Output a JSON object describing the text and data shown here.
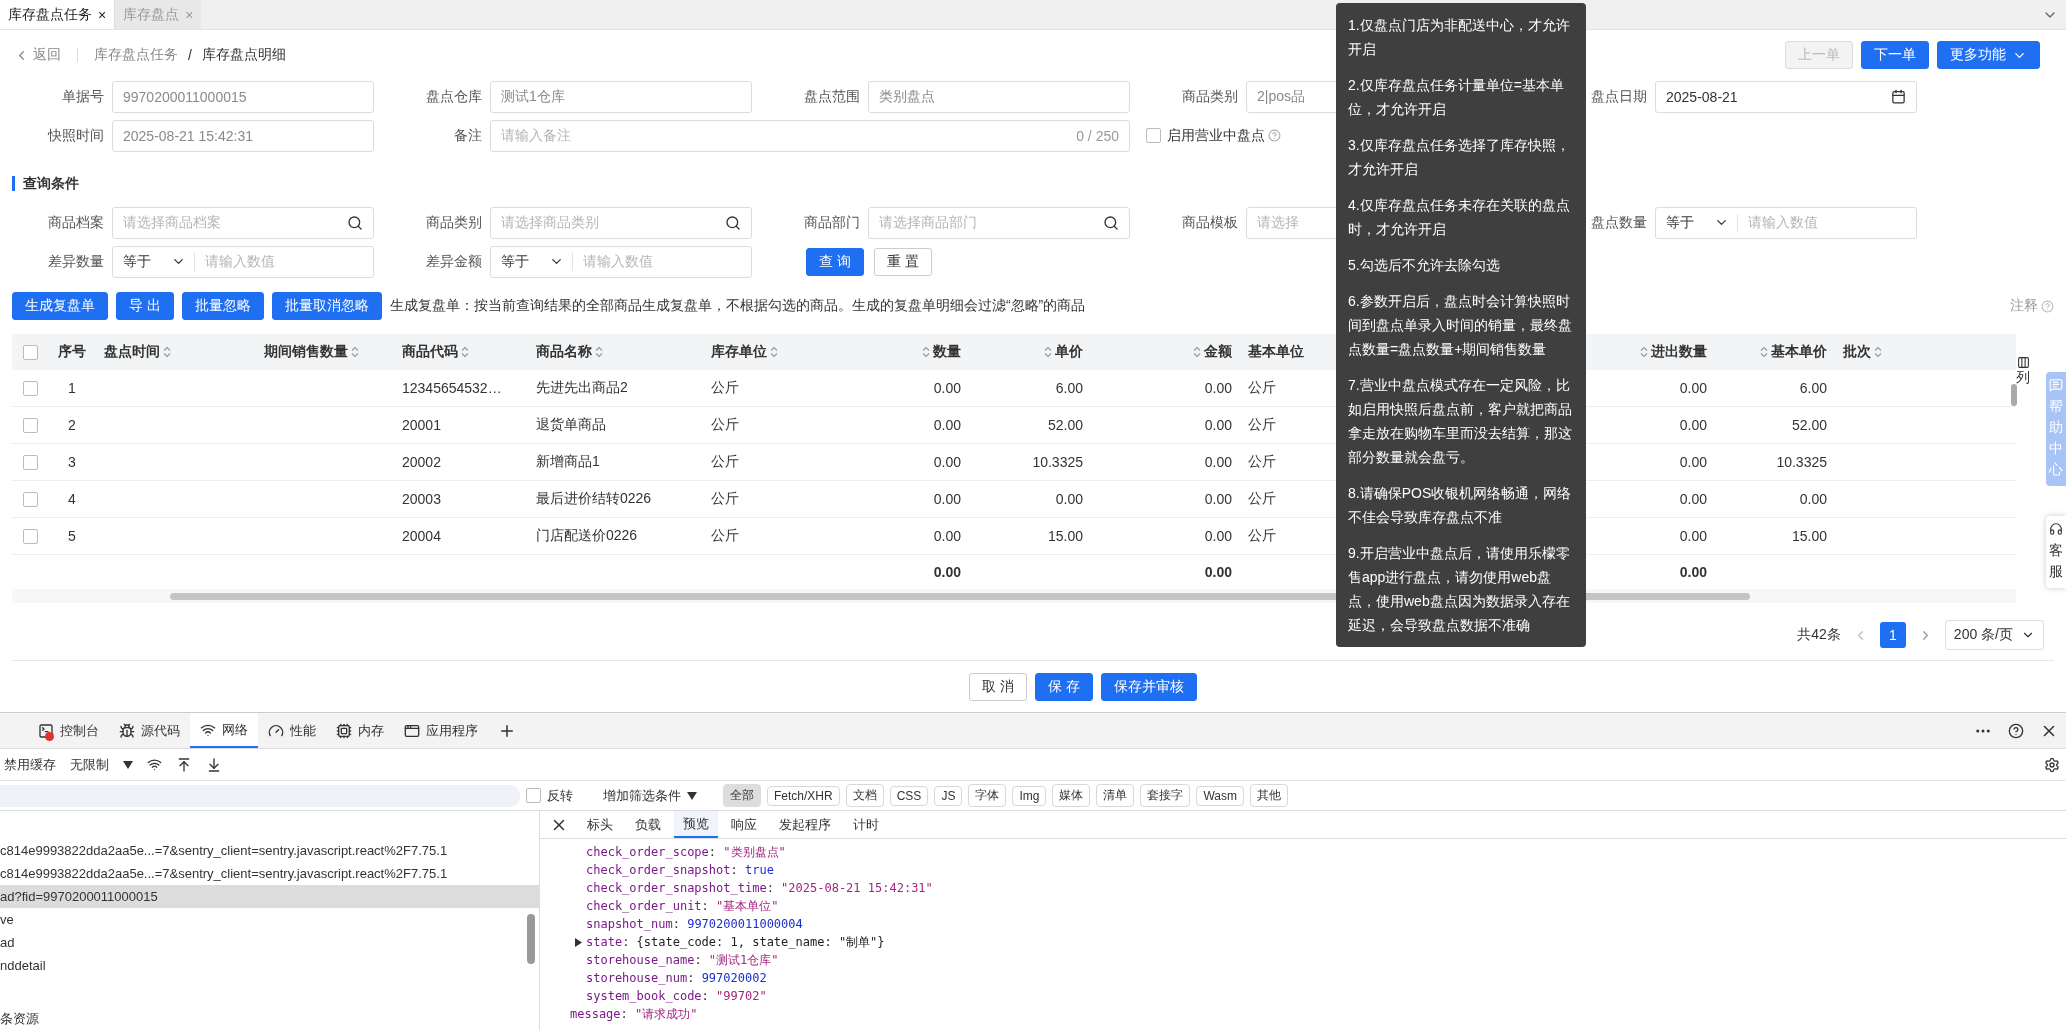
{
  "tabs": [
    {
      "label": "库存盘点任务",
      "close": "×",
      "selected": true
    },
    {
      "label": "库存盘点",
      "close": "×",
      "selected": false
    }
  ],
  "header": {
    "back": "返回",
    "breadcrumb": [
      "库存盘点任务",
      "库存盘点明细"
    ],
    "separator": "/",
    "buttons": [
      {
        "label": "上一单",
        "kind": "default",
        "disabled": true
      },
      {
        "label": "下一单",
        "kind": "primary",
        "disabled": false
      },
      {
        "label": "更多功能",
        "kind": "dropdown",
        "disabled": false
      }
    ]
  },
  "form": {
    "rows": [
      [
        {
          "label": "单据号",
          "kind": "text",
          "value": "9970200011000015",
          "disabled": true
        },
        {
          "label": "盘点仓库",
          "kind": "text",
          "value": "测试1仓库",
          "disabled": true
        },
        {
          "label": "盘点范围",
          "kind": "text",
          "value": "类别盘点",
          "disabled": true
        },
        {
          "label": "商品类别",
          "kind": "text",
          "value": "2|pos品",
          "disabled": true
        },
        {
          "label": "盘点日期",
          "kind": "date",
          "value": "2025-08-21"
        }
      ],
      [
        {
          "label": "快照时间",
          "kind": "text",
          "value": "2025-08-21 15:42:31",
          "disabled": true
        },
        {
          "label": "备注",
          "kind": "textarea",
          "placeholder": "请输入备注",
          "counter": "0 / 250"
        },
        "",
        {
          "kind": "checkbox",
          "text": "启用营业中盘点",
          "checked": false
        }
      ]
    ]
  },
  "query": {
    "title": "查询条件",
    "rows": [
      [
        {
          "label": "商品档案",
          "kind": "search",
          "placeholder": "请选择商品档案"
        },
        {
          "label": "商品类别",
          "kind": "search",
          "placeholder": "请选择商品类别"
        },
        {
          "label": "商品部门",
          "kind": "search",
          "placeholder": "请选择商品部门"
        },
        {
          "label": "商品模板",
          "kind": "partial",
          "placeholder": "请选择"
        },
        {
          "label": "盘点数量",
          "kind": "compare",
          "option": "等于",
          "placeholder": "请输入数值"
        }
      ],
      [
        {
          "label": "差异数量",
          "kind": "compare",
          "option": "等于",
          "placeholder": "请输入数值"
        },
        {
          "label": "差异金额",
          "kind": "compare",
          "option": "等于",
          "placeholder": "请输入数值"
        },
        {
          "kind": "buttons",
          "buttons": [
            {
              "label": "查 询",
              "kind": "primary"
            },
            {
              "label": "重 置",
              "kind": "default"
            }
          ]
        }
      ]
    ]
  },
  "actions": {
    "buttons": [
      "生成复盘单",
      "导 出",
      "批量忽略",
      "批量取消忽略"
    ],
    "note": "生成复盘单：按当前查询结果的全部商品生成复盘单，不根据勾选的商品。生成的复盘单明细会过滤“忽略”的商品",
    "annotation": "注释"
  },
  "table": {
    "all_selected": false,
    "column_settings": "列",
    "columns": [
      {
        "label": "序号",
        "kind": "index",
        "sortable": false
      },
      {
        "label": "盘点时间",
        "kind": "text",
        "sortable": true
      },
      {
        "label": "期间销售数量",
        "kind": "text",
        "sortable": true
      },
      {
        "label": "商品代码",
        "kind": "text",
        "sortable": true
      },
      {
        "label": "商品名称",
        "kind": "text",
        "sortable": true
      },
      {
        "label": "库存单位",
        "kind": "text",
        "sortable": true
      },
      {
        "label": "数量",
        "kind": "number",
        "sortable": true,
        "total": "0.00"
      },
      {
        "label": "单价",
        "kind": "number",
        "sortable": true
      },
      {
        "label": "金额",
        "kind": "number",
        "sortable": true,
        "total": "0.00"
      },
      {
        "label": "基本单位",
        "kind": "text",
        "sortable": false
      },
      {
        "label": "进出数量",
        "kind": "number",
        "sortable": true,
        "total": "0.00"
      },
      {
        "label": "基本单价",
        "kind": "number",
        "sortable": true
      },
      {
        "label": "批次",
        "kind": "text",
        "sortable": true
      }
    ],
    "rows": [
      {
        "selected": false,
        "cells": [
          "1",
          "",
          "",
          "12345654532…",
          "先进先出商品2",
          "公斤",
          "0.00",
          "6.00",
          "0.00",
          "公斤",
          "0.00",
          "6.00",
          ""
        ]
      },
      {
        "selected": false,
        "cells": [
          "2",
          "",
          "",
          "20001",
          "退货单商品",
          "公斤",
          "0.00",
          "52.00",
          "0.00",
          "公斤",
          "0.00",
          "52.00",
          ""
        ]
      },
      {
        "selected": false,
        "cells": [
          "3",
          "",
          "",
          "20002",
          "新增商品1",
          "公斤",
          "0.00",
          "10.3325",
          "0.00",
          "公斤",
          "0.00",
          "10.3325",
          ""
        ]
      },
      {
        "selected": false,
        "cells": [
          "4",
          "",
          "",
          "20003",
          "最后进价结转0226",
          "公斤",
          "0.00",
          "0.00",
          "0.00",
          "公斤",
          "0.00",
          "0.00",
          ""
        ]
      },
      {
        "selected": false,
        "cells": [
          "5",
          "",
          "",
          "20004",
          "门店配送价0226",
          "公斤",
          "0.00",
          "15.00",
          "0.00",
          "公斤",
          "0.00",
          "15.00",
          ""
        ]
      }
    ]
  },
  "pagination": {
    "total": "共42条",
    "pages": [
      {
        "label": "1",
        "selected": true
      }
    ],
    "page_size": "200 条/页"
  },
  "footer": {
    "buttons": [
      {
        "label": "取 消",
        "kind": "default"
      },
      {
        "label": "保 存",
        "kind": "primary"
      },
      {
        "label": "保存并审核",
        "kind": "primary"
      }
    ]
  },
  "tooltip": {
    "items": [
      "1.仅盘点门店为非配送中心，才允许开启",
      "2.仅库存盘点任务计量单位=基本单位，才允许开启",
      "3.仅库存盘点任务选择了库存快照，才允许开启",
      "4.仅库存盘点任务未存在关联的盘点时，才允许开启",
      "5.勾选后不允许去除勾选",
      "6.参数开启后，盘点时会计算快照时间到盘点单录入时间的销量，最终盘点数量=盘点数量+期间销售数量",
      "7.营业中盘点模式存在一定风险，比如启用快照后盘点前，客户就把商品拿走放在购物车里而没去结算，那这部分数量就会盘亏。",
      "8.请确保POS收银机网络畅通，网络不佳会导致库存盘点不准",
      "9.开启营业中盘点后，请使用乐檬零售app进行盘点，请勿使用web盘点，使用web盘点因为数据录入存在延迟，会导致盘点数据不准确"
    ]
  },
  "side": {
    "help": "帮助中心",
    "service": "客服"
  },
  "devtools": {
    "tabs": [
      {
        "label": "控制台",
        "kind": "console",
        "error": true,
        "selected": false
      },
      {
        "label": "源代码",
        "kind": "sources",
        "error": false,
        "selected": false
      },
      {
        "label": "网络",
        "kind": "network",
        "error": false,
        "selected": true
      },
      {
        "label": "性能",
        "kind": "performance",
        "error": false,
        "selected": false
      },
      {
        "label": "内存",
        "kind": "memory",
        "error": false,
        "selected": false
      },
      {
        "label": "应用程序",
        "kind": "application",
        "error": false,
        "selected": false
      }
    ],
    "toolbar": {
      "cache": "禁用缓存",
      "throttle": "无限制"
    },
    "filter": {
      "invert": {
        "label": "反转",
        "checked": false
      },
      "add": "增加筛选条件",
      "chips": [
        {
          "label": "全部",
          "selected": true
        },
        {
          "label": "Fetch/XHR",
          "selected": false
        },
        {
          "label": "文档",
          "selected": false
        },
        {
          "label": "CSS",
          "selected": false
        },
        {
          "label": "JS",
          "selected": false
        },
        {
          "label": "字体",
          "selected": false
        },
        {
          "label": "Img",
          "selected": false
        },
        {
          "label": "媒体",
          "selected": false
        },
        {
          "label": "清单",
          "selected": false
        },
        {
          "label": "套接字",
          "selected": false
        },
        {
          "label": "Wasm",
          "selected": false
        },
        {
          "label": "其他",
          "selected": false
        }
      ]
    },
    "requests": [
      {
        "name": "c814e9993822dda2aa5e...=7&sentry_client=sentry.javascript.react%2F7.75.1",
        "selected": false
      },
      {
        "name": "c814e9993822dda2aa5e...=7&sentry_client=sentry.javascript.react%2F7.75.1",
        "selected": false
      },
      {
        "name": "ad?fid=9970200011000015",
        "selected": true
      },
      {
        "name": "ve",
        "selected": false
      },
      {
        "name": "ad",
        "selected": false
      },
      {
        "name": "nddetail",
        "selected": false
      }
    ],
    "summary": "条资源",
    "preview": {
      "separator": ":",
      "tabs": [
        {
          "label": "标头",
          "selected": false
        },
        {
          "label": "负载",
          "selected": false
        },
        {
          "label": "预览",
          "selected": true
        },
        {
          "label": "响应",
          "selected": false
        },
        {
          "label": "发起程序",
          "selected": false
        },
        {
          "label": "计时",
          "selected": false
        }
      ],
      "entries": [
        {
          "children": [
            {
              "key": "check_order_scope",
              "value": "\"类别盘点\"",
              "kind": "string"
            },
            {
              "key": "check_order_snapshot",
              "value": "true",
              "kind": "literal"
            },
            {
              "key": "check_order_snapshot_time",
              "value": "\"2025-08-21 15:42:31\"",
              "kind": "string"
            },
            {
              "key": "check_order_unit",
              "value": "\"基本单位\"",
              "kind": "string"
            },
            {
              "key": "snapshot_num",
              "value": "9970200011000004",
              "kind": "literal"
            },
            {
              "key": "state",
              "value": "{state_code: 1, state_name: \"制单\"}",
              "kind": "object",
              "expanded": false
            },
            {
              "key": "storehouse_name",
              "value": "\"测试1仓库\"",
              "kind": "string"
            },
            {
              "key": "storehouse_num",
              "value": "997020002",
              "kind": "literal"
            },
            {
              "key": "system_book_code",
              "value": "\"99702\"",
              "kind": "string"
            }
          ]
        },
        {
          "key": "message",
          "value": "\"请求成功\"",
          "kind": "string"
        }
      ]
    }
  }
}
